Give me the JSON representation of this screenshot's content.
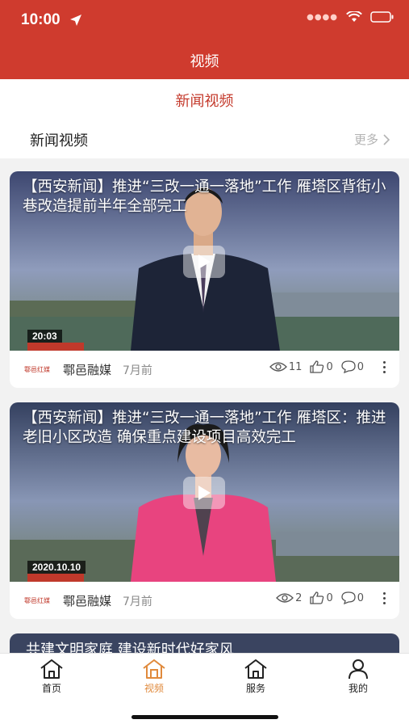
{
  "status_bar": {
    "time": "10:00"
  },
  "nav": {
    "title": "视频"
  },
  "tab": {
    "label": "新闻视频"
  },
  "section": {
    "title": "新闻视频",
    "more": "更多"
  },
  "cards": [
    {
      "title": "【西安新闻】推进“三改一通一落地”工作 雁塔区背街小巷改造提前半年全部完工",
      "date_tag": "20:03",
      "source": "鄠邑融媒",
      "time_ago": "7月前",
      "views": "11",
      "likes": "0",
      "comments": "0"
    },
    {
      "title": "【西安新闻】推进“三改一通一落地”工作 雁塔区：推进老旧小区改造 确保重点建设项目高效完工",
      "date_tag": "2020.10.10",
      "source": "鄠邑融媒",
      "time_ago": "7月前",
      "views": "2",
      "likes": "0",
      "comments": "0"
    },
    {
      "title": "共建文明家庭 建设新时代好家风"
    }
  ],
  "tabbar": {
    "home": "首页",
    "video": "视频",
    "service": "服务",
    "mine": "我的"
  },
  "colors": {
    "brand": "#cf3b2e",
    "active_tab": "#e08a3c"
  }
}
